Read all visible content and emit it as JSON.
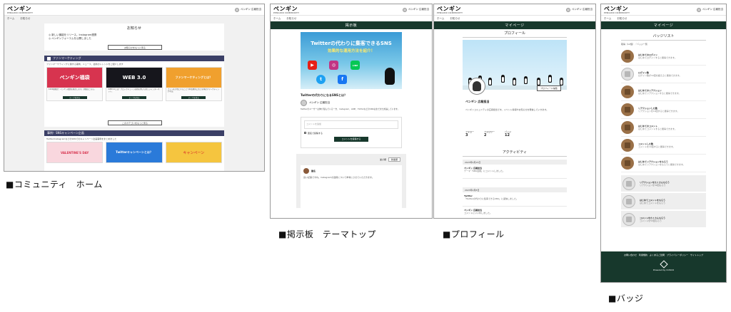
{
  "brand": {
    "logo": "ペンギン",
    "sub": "PENGUIN COMMUNITY",
    "user": "ペンギン 広報担当"
  },
  "nav": {
    "home": "ホーム",
    "about": "お知らせ"
  },
  "captions": [
    "■コミュニティ　ホーム",
    "■掲示板　テーマトップ",
    "■プロフィール",
    "■バッジ"
  ],
  "home": {
    "notice_title": "お知らせ",
    "notices": [
      "◎ 新しい機能をリリース。Instagram連携",
      "◎ ペンギンフォーラムを公開しました"
    ],
    "notice_button": "お知らせをもっと見る",
    "sec1_title": "ファンマーケティング",
    "sec1_desc": "ファンマーケティングに関する事例、ニュース、最新のトレンドをご紹介します",
    "cards": [
      {
        "image_text": "ペンギン福袋",
        "text": "1000個限定！ペンギン福袋を発売します。詳細はこちら。",
        "button": "テーマを見る",
        "color": "#d7344f"
      },
      {
        "image_text": "WEB 3.0",
        "text": "WEB3.0とは？ブロックチェーン技術を用いた新しいインターネット。",
        "button": "テーマを見る",
        "color": "#16161c"
      },
      {
        "image_text": "ファンマーケティングとは？",
        "text": "ファンを大切にすることで中長期的に売上を伸ばすマーケティング手法。",
        "button": "テーマを見る",
        "color": "#f0a02e"
      }
    ],
    "more_button": "このカテゴリをもっと見る",
    "sec2_title": "事例！SNSキャンペーン企画",
    "sec2_desc": "Twitter/InstagramなどのSNSでのキャンペーン企画事例をまとめました",
    "cards2": [
      {
        "image_text": "VALENTINE'S DAY",
        "color": "#f9d7de"
      },
      {
        "image_text": "Twitterキャンペーンとは？",
        "color": "#2a7ad9"
      },
      {
        "image_text": "キャンペーン",
        "color": "#f5c53f"
      }
    ]
  },
  "board": {
    "title": "掲示板",
    "hero_title": "Twitterの代わりに集客できるSNS",
    "hero_sub": "効果的な運用方法を紹介！",
    "post_title": "Twitterの代わりになるSNSとは？",
    "author": "ペンギン 広報担当",
    "body": "Twitterのユーザーは伸び悩んでいる一方、Instagram、LINE、TikTokなどのSNSはまだまだ成長しています。",
    "comment_placeholder": "コメントを追加",
    "anonymous": "匿名で投稿する",
    "submit": "コメントを投稿する",
    "sort_label": "並び順",
    "sort_value": "新着順",
    "commenter": "匿名",
    "comment_body": "良い記事ですね。Instagramの運用について参考にさせていただきます。"
  },
  "profile": {
    "title": "マイページ",
    "tab": "プロフィール",
    "edit_button": "プロフィール編集",
    "name": "ペンギン 広報担当",
    "bio": "ペンギンコミュニティの広報担当です。イベント情報やお知らせを発信していきます。",
    "stats": [
      {
        "label": "フォロー",
        "value": "3"
      },
      {
        "label": "フォロワー",
        "value": "2"
      },
      {
        "label": "バッジ",
        "value": "12"
      }
    ],
    "activity_title": "アクティビティ",
    "dates": [
      "2023年2月15日",
      "2023年2月8日"
    ],
    "activities": [
      {
        "who": "ペンギン 広報担当",
        "text": "テーマ「SNS活用」にコメントしました。"
      },
      {
        "who": "Twitter",
        "text": "「Twitterの代わりに集客できるSNS」に返信しました。"
      },
      {
        "who": "ペンギン 広報担当",
        "text": "コメントにいいねしました。"
      }
    ]
  },
  "badges": {
    "title": "マイページ",
    "tab": "バッジリスト",
    "count": "取得（12個）／バッジ一覧",
    "earned": [
      {
        "name": "はじめてのログイン",
        "desc": "はじめてログインすると獲得できます。"
      },
      {
        "name": "ログイン数",
        "desc": "ログイン数が10回を超えると獲得できます。"
      },
      {
        "name": "はじめてのリアクション",
        "desc": "はじめてリアクションすると獲得できます。"
      },
      {
        "name": "リアクションした数",
        "desc": "リアクションを10回すると獲得できます。"
      },
      {
        "name": "はじめてのコメント",
        "desc": "はじめてコメントすると獲得できます。"
      },
      {
        "name": "コメントした数",
        "desc": "コメントを10回すると獲得できます。"
      },
      {
        "name": "はじめてリアクションをもらう",
        "desc": "はじめてリアクションをもらうと獲得できます。"
      }
    ],
    "locked": [
      {
        "name": "リアクションをたくさんもらう",
        "desc": "リアクションを50回もらう"
      },
      {
        "name": "はじめてコメントをもらう",
        "desc": "はじめてコメントをもらう"
      },
      {
        "name": "コメントをたくさんもらう",
        "desc": "コメントを50回もらう"
      }
    ],
    "footer_links": "お問い合わせ　利用規約　よくあるご質問　プライバシーポリシー　サイトトップ",
    "powered": "Powered by COSCO"
  },
  "colors": {
    "accent": "#17382c",
    "section": "#3b3f66",
    "badge": "#9a7047"
  }
}
